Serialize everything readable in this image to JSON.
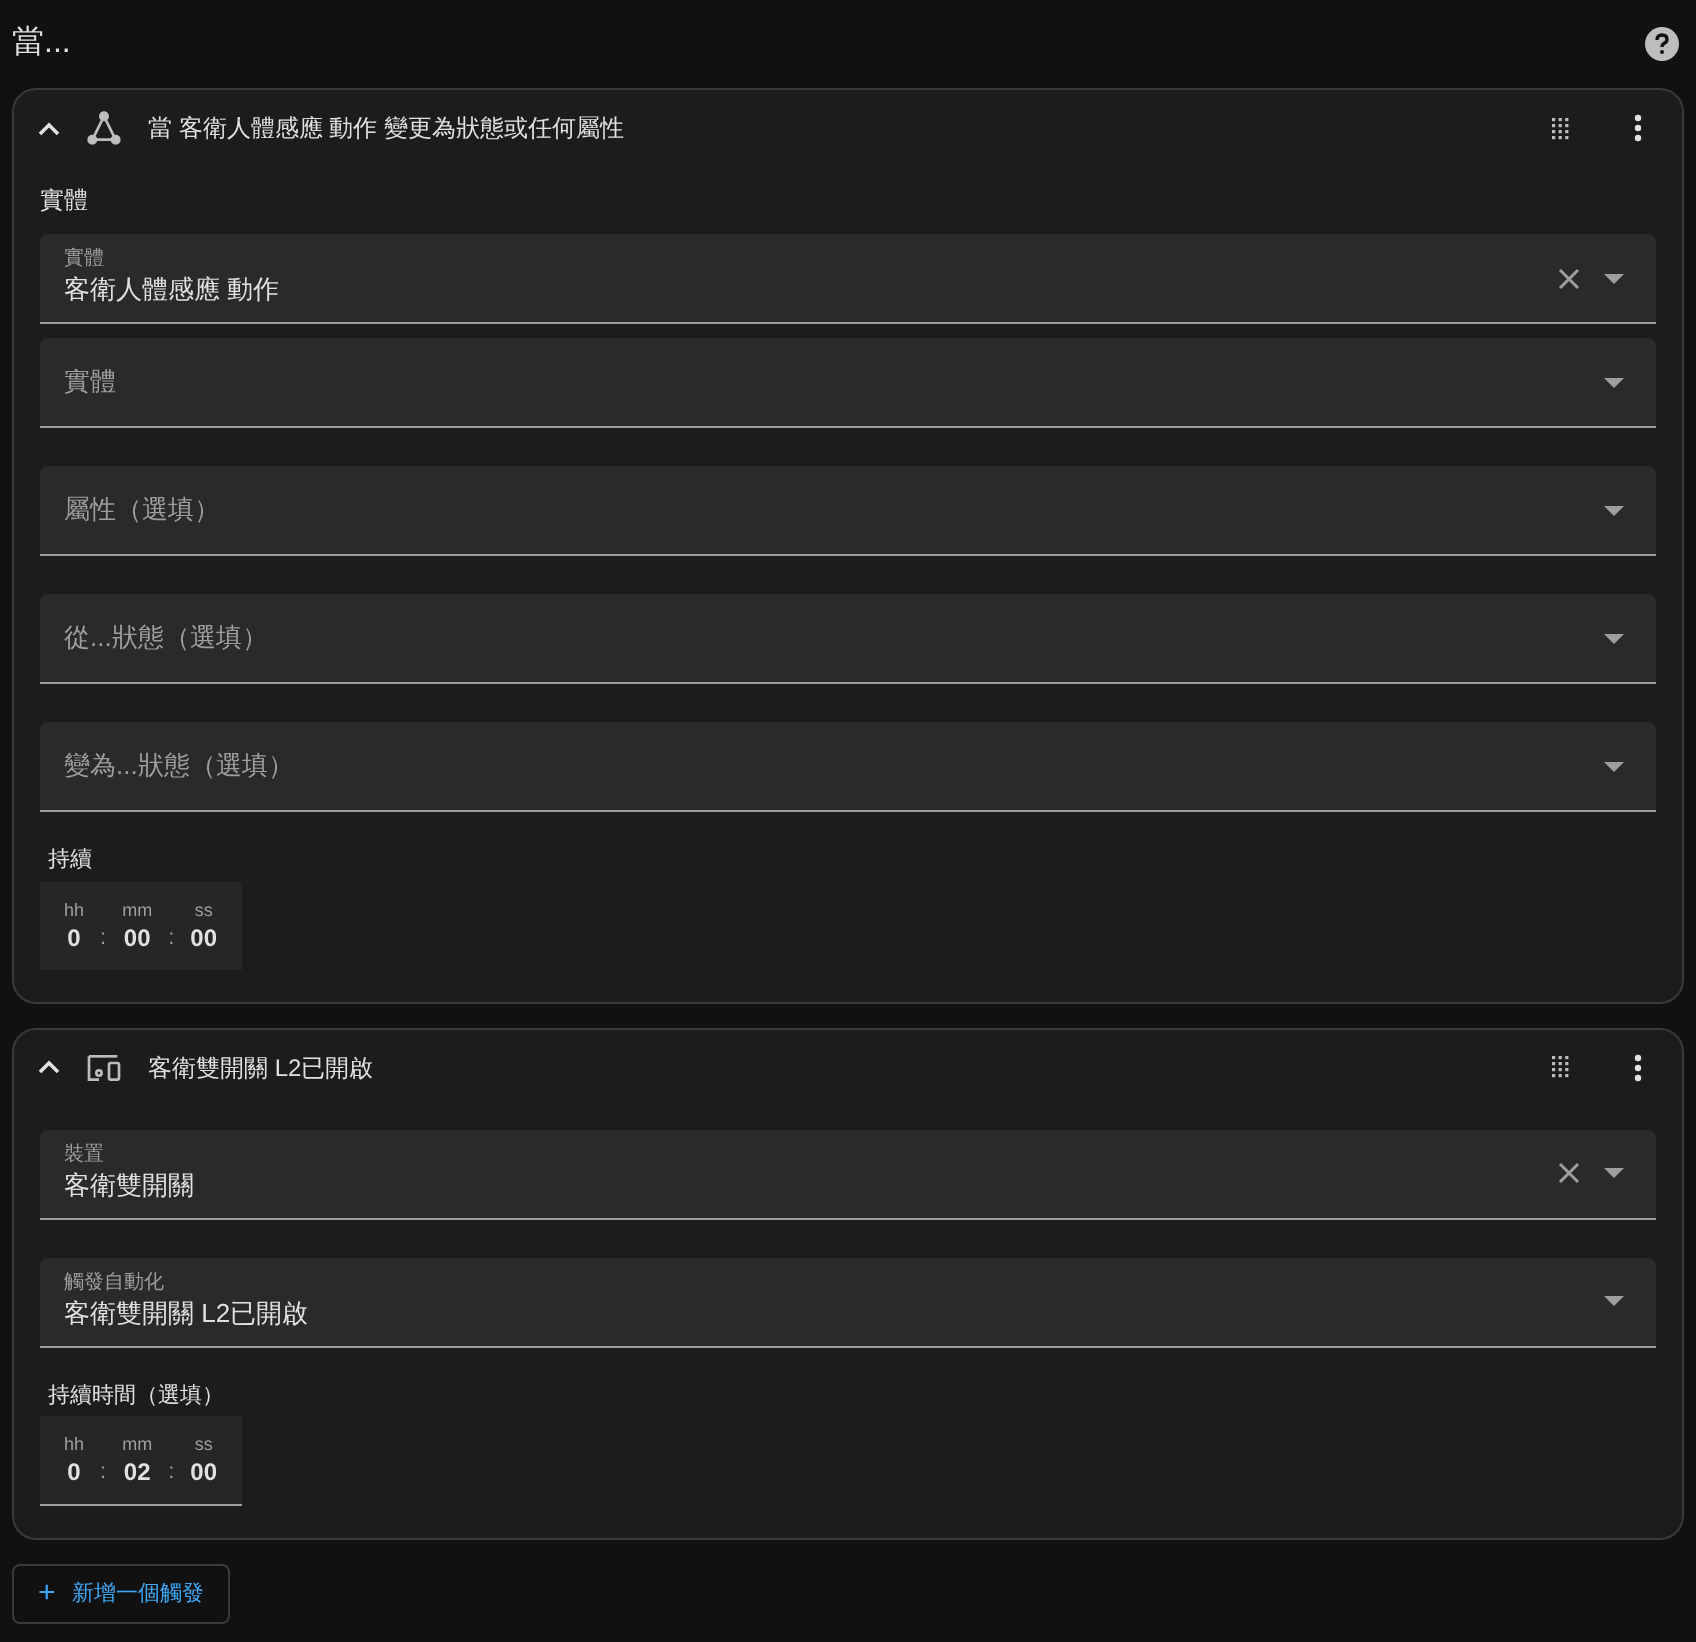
{
  "title": "當...",
  "triggers": [
    {
      "kind": "state",
      "header": "當 客衛人體感應 動作 變更為狀態或任何屬性",
      "section": "實體",
      "fields": [
        {
          "label": "實體",
          "value": "客衛人體感應 動作",
          "clearable": true
        },
        {
          "label": "實體",
          "clearable": false
        },
        {
          "label": "屬性（選填）",
          "clearable": false
        },
        {
          "label": "從...狀態（選填）",
          "clearable": false
        },
        {
          "label": "變為...狀態（選填）",
          "clearable": false
        }
      ],
      "duration": {
        "label": "持續",
        "hh_label": "hh",
        "mm_label": "mm",
        "ss_label": "ss",
        "hh": "0",
        "mm": "00",
        "ss": "00",
        "separator": ":",
        "underlined": false
      }
    },
    {
      "kind": "device",
      "header": "客衛雙開關 L2已開啟",
      "fields": [
        {
          "label": "裝置",
          "value": "客衛雙開關",
          "clearable": true
        },
        {
          "label": "觸發自動化",
          "value": "客衛雙開關 L2已開啟",
          "clearable": false
        }
      ],
      "duration": {
        "label": "持續時間（選填）",
        "hh_label": "hh",
        "mm_label": "mm",
        "ss_label": "ss",
        "hh": "0",
        "mm": "02",
        "ss": "00",
        "separator": ":",
        "underlined": true
      }
    }
  ],
  "add_button": {
    "icon": "+",
    "label": "新增一個觸發"
  }
}
